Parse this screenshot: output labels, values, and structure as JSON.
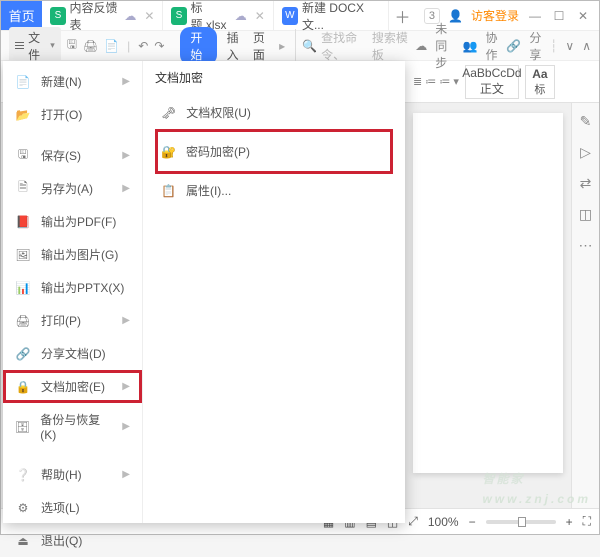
{
  "titlebar": {
    "home": "首页",
    "tabs": [
      {
        "icon": "s",
        "label": "内容反馈表"
      },
      {
        "icon": "s",
        "label": "标题.xlsx"
      },
      {
        "icon": "w",
        "label": "新建 DOCX 文..."
      }
    ],
    "cloud_num": "3",
    "login": "访客登录",
    "min": "—",
    "max": "☐",
    "close": "✕"
  },
  "toolbar": {
    "file_label": "文件",
    "ribbon": {
      "start": "开始",
      "insert": "插入",
      "page": "页面"
    },
    "search_prefix": "查找命令、",
    "search_placeholder": "搜索模板",
    "sync": "未同步",
    "collab": "协作",
    "share": "分享"
  },
  "ribbon_ctrls": {
    "style_name": "AaBbCcDd",
    "style_caption": "正文",
    "alt": "标"
  },
  "file_menu": {
    "heading": "文档加密",
    "col1": [
      {
        "key": "new",
        "label": "新建(N)",
        "chev": true
      },
      {
        "key": "open",
        "label": "打开(O)"
      },
      {
        "key": "save",
        "label": "保存(S)",
        "chev": true
      },
      {
        "key": "saveas",
        "label": "另存为(A)",
        "chev": true
      },
      {
        "key": "pdf",
        "label": "输出为PDF(F)"
      },
      {
        "key": "img",
        "label": "输出为图片(G)"
      },
      {
        "key": "pptx",
        "label": "输出为PPTX(X)"
      },
      {
        "key": "print",
        "label": "打印(P)",
        "chev": true
      },
      {
        "key": "sharedoc",
        "label": "分享文档(D)"
      },
      {
        "key": "encrypt",
        "label": "文档加密(E)",
        "chev": true,
        "highlight": true
      },
      {
        "key": "backup",
        "label": "备份与恢复(K)",
        "chev": true
      },
      {
        "key": "help",
        "label": "帮助(H)",
        "chev": true
      },
      {
        "key": "options",
        "label": "选项(L)"
      },
      {
        "key": "exit",
        "label": "退出(Q)"
      }
    ],
    "col2": [
      {
        "key": "perm",
        "label": "文档权限(U)"
      },
      {
        "key": "pwd",
        "label": "密码加密(P)",
        "highlight": true
      },
      {
        "key": "props",
        "label": "属性(I)..."
      }
    ]
  },
  "statusbar": {
    "zoom": "100%",
    "minus": "−",
    "plus": "+"
  },
  "watermark": {
    "big": "智能家",
    "small": "www.znj.com"
  }
}
